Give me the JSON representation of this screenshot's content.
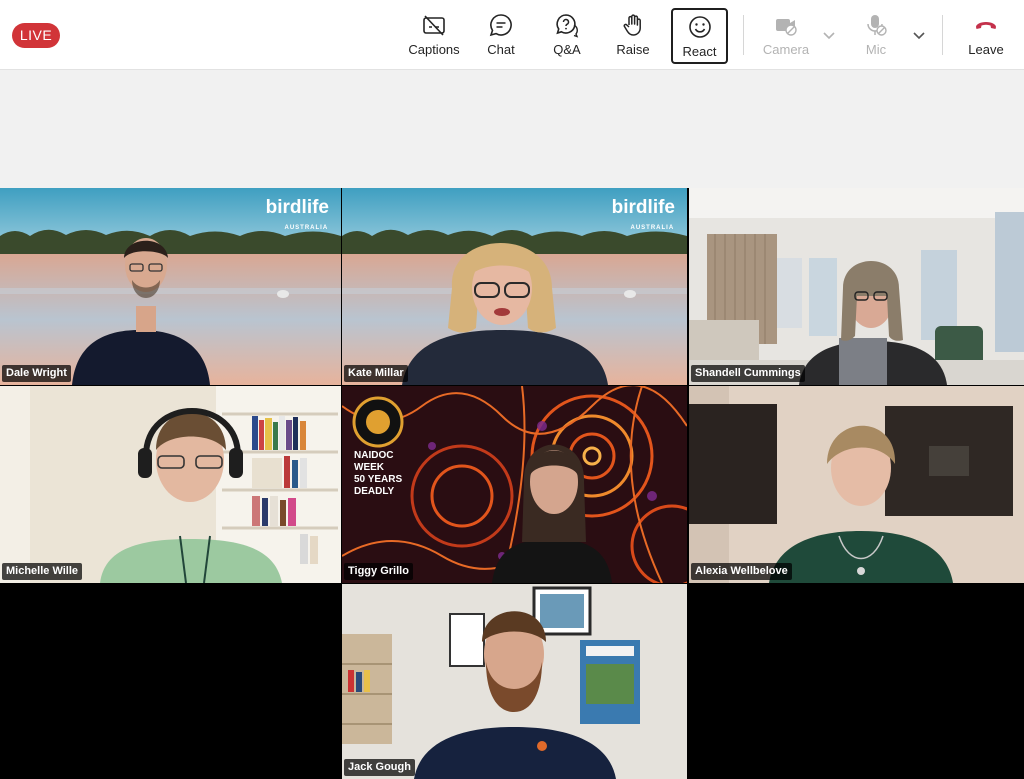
{
  "meeting": {
    "live_label": "LIVE",
    "colors": {
      "live": "#d13438",
      "leave": "#c4314b",
      "text": "#242424",
      "disabled": "#b3b3b3"
    }
  },
  "toolbar": {
    "captions": {
      "label": "Captions",
      "icon": "captions-off-icon"
    },
    "chat": {
      "label": "Chat",
      "icon": "chat-icon"
    },
    "qa": {
      "label": "Q&A",
      "icon": "question-bubble-icon"
    },
    "raise": {
      "label": "Raise",
      "icon": "raise-hand-icon"
    },
    "react": {
      "label": "React",
      "icon": "smiley-icon",
      "active": true
    },
    "camera": {
      "label": "Camera",
      "icon": "camera-off-icon",
      "disabled": true
    },
    "mic": {
      "label": "Mic",
      "icon": "mic-off-icon",
      "disabled": true
    },
    "leave": {
      "label": "Leave",
      "icon": "phone-hangup-icon"
    }
  },
  "participants": [
    {
      "name": "Dale Wright",
      "background": "birdlife"
    },
    {
      "name": "Kate Millar",
      "background": "birdlife"
    },
    {
      "name": "Shandell Cummings",
      "background": "apartment"
    },
    {
      "name": "Michelle Wille",
      "background": "bookshelf"
    },
    {
      "name": "Tiggy Grillo",
      "background": "naidoc"
    },
    {
      "name": "Alexia Wellbelove",
      "background": "blurred-room"
    },
    {
      "name": "Jack Gough",
      "background": "office"
    }
  ],
  "backgrounds": {
    "birdlife_brand": "birdlife",
    "birdlife_sub": "AUSTRALIA",
    "naidoc_text": [
      "NAIDOC",
      "WEEK",
      "50 YEARS",
      "DEADLY"
    ]
  }
}
